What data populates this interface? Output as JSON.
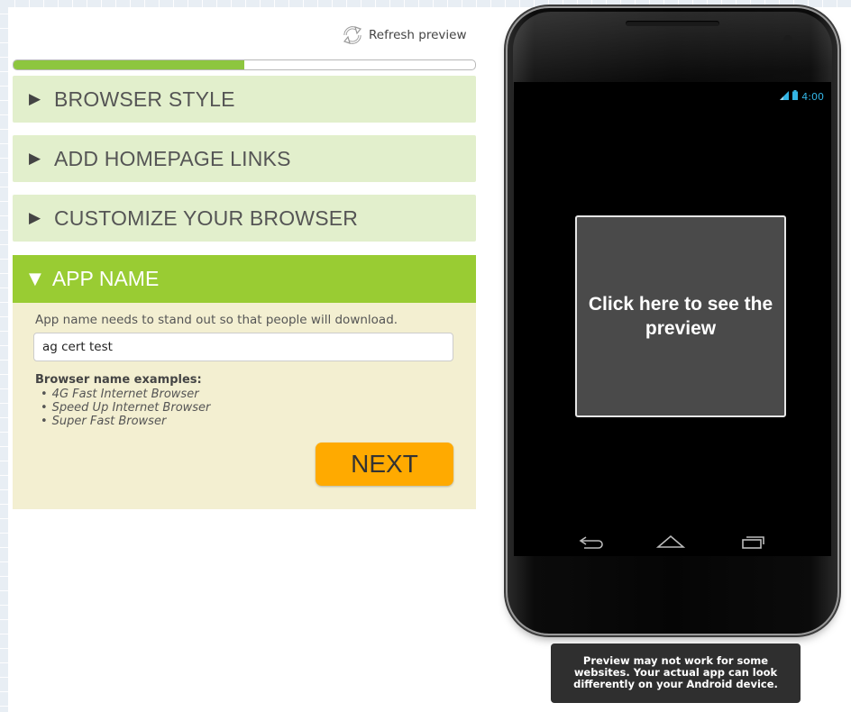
{
  "toolbar": {
    "refresh_label": "Refresh preview",
    "refresh_icon": "refresh-icon"
  },
  "progress": {
    "value_percent": 50,
    "color": "#8dc63f"
  },
  "sections": [
    {
      "label": "BROWSER STYLE",
      "expanded": false
    },
    {
      "label": "ADD HOMEPAGE LINKS",
      "expanded": false
    },
    {
      "label": "CUSTOMIZE YOUR BROWSER",
      "expanded": false
    },
    {
      "label": "APP NAME",
      "expanded": true
    }
  ],
  "app_name_panel": {
    "description": "App name needs to stand out so that people will download.",
    "input_value": "ag cert test",
    "examples_title": "Browser name examples:",
    "examples": [
      "4G Fast Internet Browser",
      "Speed Up Internet Browser",
      "Super Fast Browser"
    ],
    "next_label": "NEXT"
  },
  "phone": {
    "status_time": "4:00",
    "preview_text": "Click here to see the preview",
    "icons": [
      "signal-icon",
      "battery-icon",
      "back-icon",
      "home-icon",
      "recent-apps-icon"
    ]
  },
  "tooltip": {
    "text": "Preview may not work for some websites. Your actual app can look differently on your Android device."
  },
  "colors": {
    "accent_green": "#99cc33",
    "section_bg": "#e2efcc",
    "panel_bg": "#f3efd1",
    "next_button": "#ffaa00",
    "status_blue": "#33b5e5"
  }
}
